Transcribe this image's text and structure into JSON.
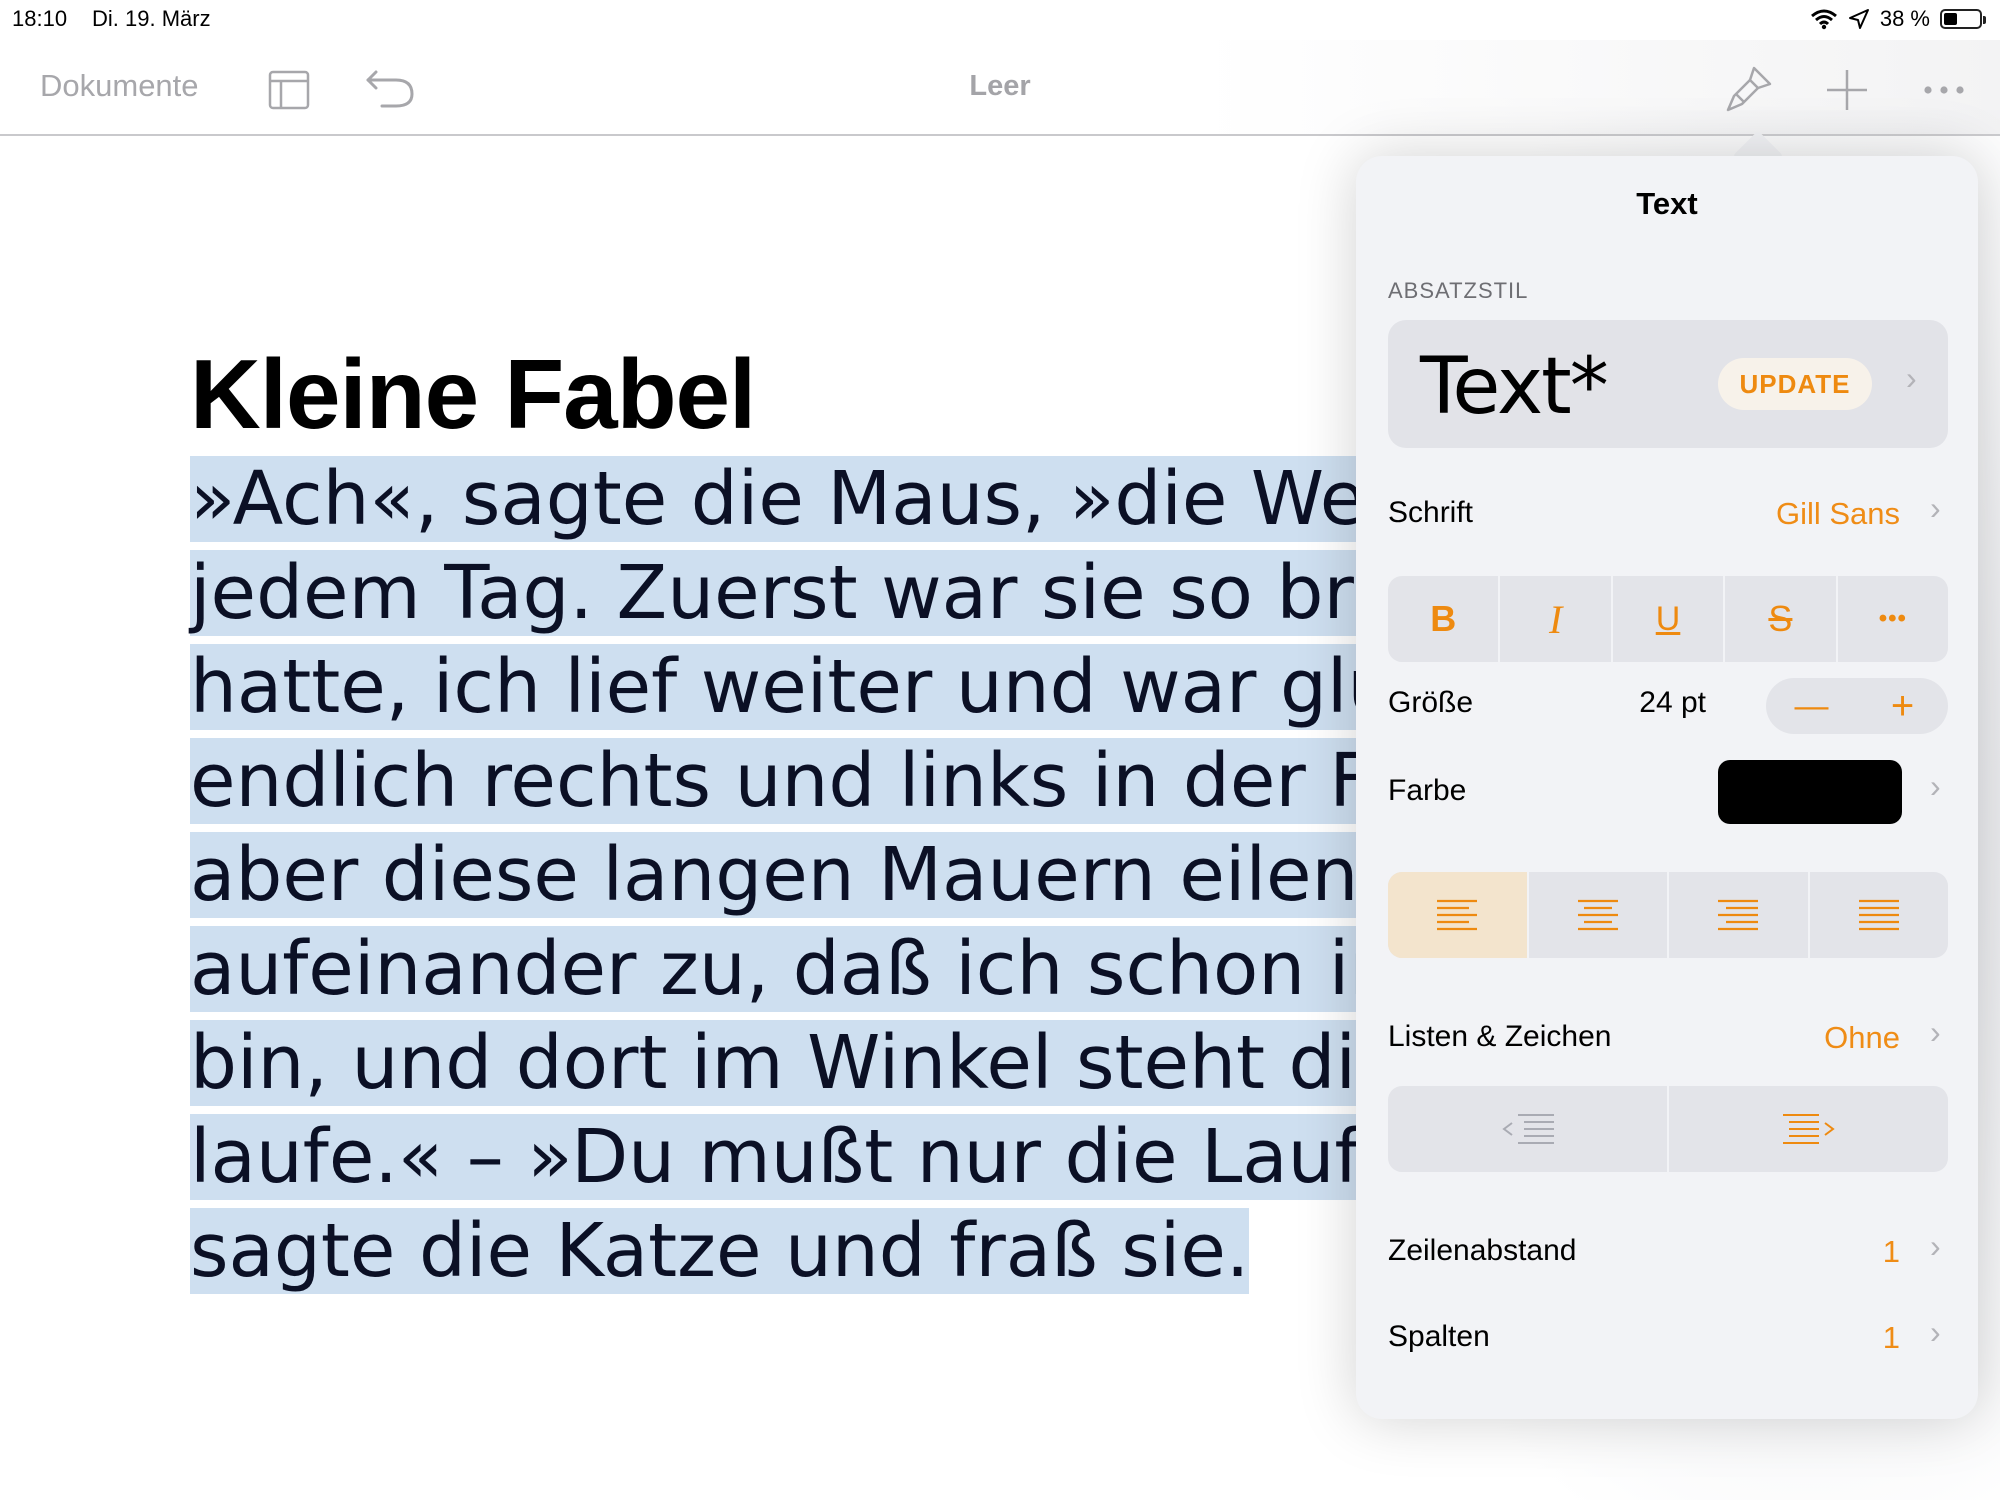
{
  "status_bar": {
    "time": "18:10",
    "date": "Di. 19. März",
    "battery_text": "38 %",
    "battery_level": 0.38
  },
  "toolbar": {
    "documents_label": "Dokumente",
    "title": "Leer"
  },
  "document": {
    "title": "Kleine Fabel",
    "body_lines": [
      "»Ach«, sagte die Maus, »die Welt wi",
      "jedem Tag. Zuerst war sie so breit, d",
      "hatte, ich lief weiter und war glückli",
      "endlich rechts und links in der Ferne",
      "aber diese langen Mauern eilen so s",
      "aufeinander zu, daß ich schon im let",
      "bin, und dort im Winkel steht die Fa",
      "laufe.« – »Du mußt nur die Laufrich",
      "sagte die Katze und fraß sie."
    ],
    "selection_color": "#cedff0"
  },
  "popover": {
    "title": "Text",
    "paragraph_style_section": "ABSATZSTIL",
    "paragraph_style_name": "Text*",
    "update_label": "UPDATE",
    "font_label": "Schrift",
    "font_value": "Gill Sans",
    "style_buttons": {
      "bold": "B",
      "italic": "I",
      "underline": "U",
      "strikethrough": "S",
      "more": "•••"
    },
    "size_label": "Größe",
    "size_value": "24 pt",
    "stepper": {
      "minus": "—",
      "plus": "+"
    },
    "color_label": "Farbe",
    "color_value": "#000000",
    "alignment_active": "left",
    "lists_label": "Listen & Zeichen",
    "lists_value": "Ohne",
    "line_spacing_label": "Zeilenabstand",
    "line_spacing_value": "1",
    "columns_label": "Spalten",
    "columns_value": "1",
    "accent_color": "#ee8a10"
  }
}
